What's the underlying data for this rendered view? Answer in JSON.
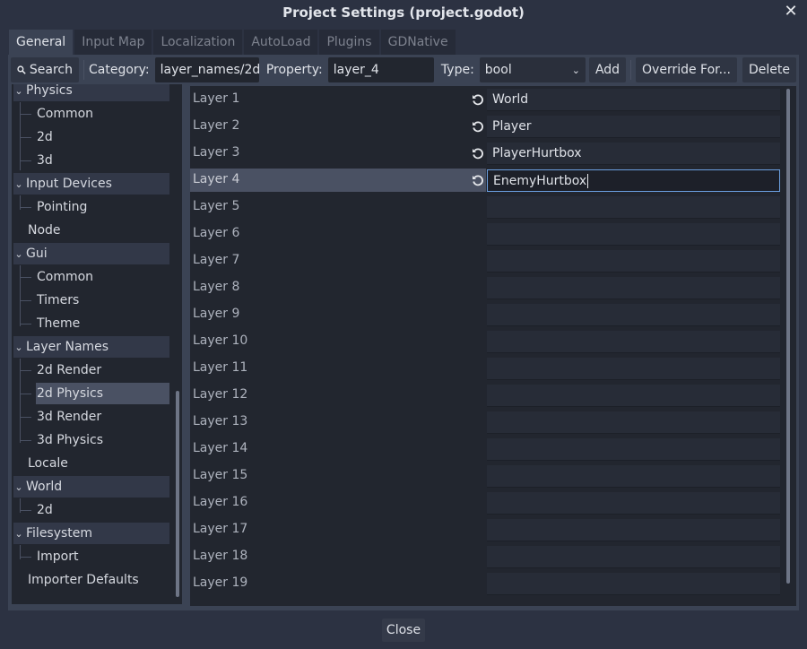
{
  "window": {
    "title": "Project Settings (project.godot)",
    "close_icon": "close-icon"
  },
  "tabs": [
    {
      "label": "General",
      "active": true
    },
    {
      "label": "Input Map"
    },
    {
      "label": "Localization"
    },
    {
      "label": "AutoLoad"
    },
    {
      "label": "Plugins"
    },
    {
      "label": "GDNative"
    }
  ],
  "toolbar": {
    "search_label": "Search",
    "category_label": "Category:",
    "category_value": "layer_names/2d",
    "property_label": "Property:",
    "property_value": "layer_4",
    "type_label": "Type:",
    "type_value": "bool",
    "add_label": "Add",
    "override_label": "Override For...",
    "delete_label": "Delete"
  },
  "tree": {
    "items": [
      {
        "label": "Physics",
        "level": 0,
        "section": true
      },
      {
        "label": "Common",
        "level": 1
      },
      {
        "label": "2d",
        "level": 1
      },
      {
        "label": "3d",
        "level": 1
      },
      {
        "label": "Input Devices",
        "level": 0,
        "section": true
      },
      {
        "label": "Pointing",
        "level": 1
      },
      {
        "label": "Node",
        "level": 0
      },
      {
        "label": "Gui",
        "level": 0,
        "section": true
      },
      {
        "label": "Common",
        "level": 1
      },
      {
        "label": "Timers",
        "level": 1
      },
      {
        "label": "Theme",
        "level": 1
      },
      {
        "label": "Layer Names",
        "level": 0,
        "section": true
      },
      {
        "label": "2d Render",
        "level": 1
      },
      {
        "label": "2d Physics",
        "level": 1,
        "selected": true
      },
      {
        "label": "3d Render",
        "level": 1
      },
      {
        "label": "3d Physics",
        "level": 1
      },
      {
        "label": "Locale",
        "level": 0
      },
      {
        "label": "World",
        "level": 0,
        "section": true
      },
      {
        "label": "2d",
        "level": 1
      },
      {
        "label": "Filesystem",
        "level": 0,
        "section": true
      },
      {
        "label": "Import",
        "level": 1
      },
      {
        "label": "Importer Defaults",
        "level": 0
      }
    ]
  },
  "properties": [
    {
      "name": "Layer 1",
      "value": "World",
      "revert": true
    },
    {
      "name": "Layer 2",
      "value": "Player",
      "revert": true
    },
    {
      "name": "Layer 3",
      "value": "PlayerHurtbox",
      "revert": true
    },
    {
      "name": "Layer 4",
      "value": "EnemyHurtbox",
      "revert": true,
      "selected": true,
      "editing": true
    },
    {
      "name": "Layer 5",
      "value": ""
    },
    {
      "name": "Layer 6",
      "value": ""
    },
    {
      "name": "Layer 7",
      "value": ""
    },
    {
      "name": "Layer 8",
      "value": ""
    },
    {
      "name": "Layer 9",
      "value": ""
    },
    {
      "name": "Layer 10",
      "value": ""
    },
    {
      "name": "Layer 11",
      "value": ""
    },
    {
      "name": "Layer 12",
      "value": ""
    },
    {
      "name": "Layer 13",
      "value": ""
    },
    {
      "name": "Layer 14",
      "value": ""
    },
    {
      "name": "Layer 15",
      "value": ""
    },
    {
      "name": "Layer 16",
      "value": ""
    },
    {
      "name": "Layer 17",
      "value": ""
    },
    {
      "name": "Layer 18",
      "value": ""
    },
    {
      "name": "Layer 19",
      "value": ""
    }
  ],
  "footer": {
    "close_label": "Close"
  },
  "colors": {
    "accent": "#6b9fe0",
    "background": "#2c3242",
    "panel": "#3b4354"
  }
}
